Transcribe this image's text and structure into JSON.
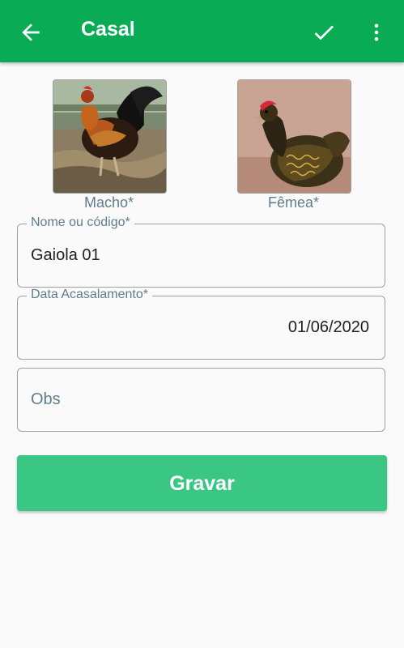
{
  "appbar": {
    "title": "Casal",
    "bg_color": "#0aab55",
    "back_icon": "arrow-left-icon",
    "confirm_icon": "check-icon",
    "menu_icon": "more-vert-icon"
  },
  "photos": {
    "male_label": "Macho*",
    "female_label": "Fêmea*"
  },
  "form": {
    "name_label": "Nome ou código*",
    "name_value": "Gaiola 01",
    "date_label": "Data Acasalamento*",
    "date_value": "01/06/2020",
    "obs_placeholder": "Obs"
  },
  "save_button": {
    "label": "Gravar",
    "color": "#3ac784"
  }
}
